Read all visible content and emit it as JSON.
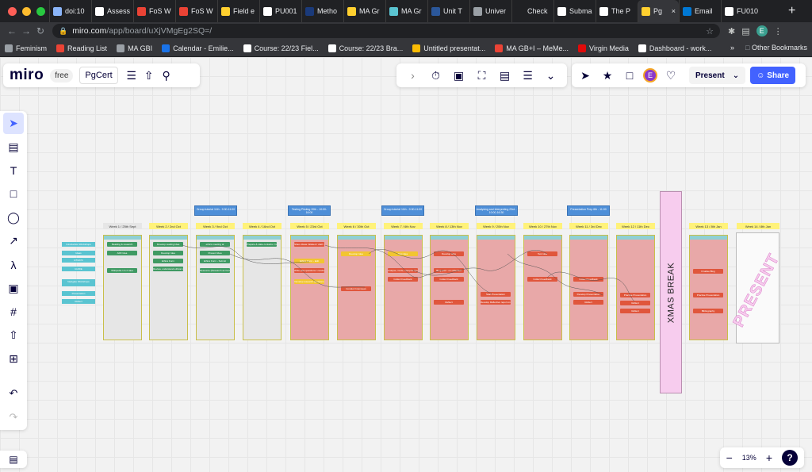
{
  "browser": {
    "tabs": [
      {
        "label": "doi:10",
        "color": "#8ab4f8"
      },
      {
        "label": "Assess",
        "color": "#ffffff"
      },
      {
        "label": "FoS W",
        "color": "#ea4335"
      },
      {
        "label": "FoS W",
        "color": "#ea4335"
      },
      {
        "label": "Field e",
        "color": "#ffd02f"
      },
      {
        "label": "PU001",
        "color": "#ffffff"
      },
      {
        "label": "Metho",
        "color": "#1a3a7a"
      },
      {
        "label": "MA Gr",
        "color": "#ffd02f"
      },
      {
        "label": "MA Gr",
        "color": "#5ac4d1"
      },
      {
        "label": "Unit T",
        "color": "#2b579a"
      },
      {
        "label": "Univer",
        "color": "#9aa0a6"
      },
      {
        "label": "Check",
        "color": "#202124"
      },
      {
        "label": "Subma",
        "color": "#ffffff"
      },
      {
        "label": "The P",
        "color": "#ffffff"
      },
      {
        "label": "Pg",
        "color": "#ffd02f",
        "active": true
      },
      {
        "label": "Email",
        "color": "#0078d4"
      },
      {
        "label": "FU010",
        "color": "#ffffff"
      }
    ],
    "new_tab": "+",
    "url_host": "miro.com",
    "url_path": "/app/board/uXjVMgEg2SQ=/",
    "profile_initial": "E",
    "bookmarks": [
      {
        "label": "Feminism",
        "color": "#9aa0a6"
      },
      {
        "label": "Reading List",
        "color": "#ea4335"
      },
      {
        "label": "MA GBI",
        "color": "#9aa0a6"
      },
      {
        "label": "Calendar - Emilie...",
        "color": "#1a73e8"
      },
      {
        "label": "Course: 22/23 Fiel...",
        "color": "#ffffff"
      },
      {
        "label": "Course: 22/23 Bra...",
        "color": "#ffffff"
      },
      {
        "label": "Untitled presentat...",
        "color": "#fbbc04"
      },
      {
        "label": "MA GB+I – MeMe...",
        "color": "#ea4335"
      },
      {
        "label": "Virgin Media",
        "color": "#e10a0a"
      },
      {
        "label": "Dashboard - work...",
        "color": "#ffffff"
      }
    ],
    "bookmarks_more": "»",
    "other_bookmarks": "Other Bookmarks"
  },
  "miro": {
    "logo": "miro",
    "plan": "free",
    "board_name": "PgCert",
    "present_label": "Present",
    "share_label": "Share",
    "user_initial": "E",
    "zoom_level": "13%",
    "zoom_out": "−",
    "zoom_in": "+",
    "help": "?"
  },
  "board": {
    "weeks": [
      "Week 1 / 25th Sept",
      "Week 2 / 2nd Oct",
      "Week 3 / 9nd Oct",
      "Week 4 / 16nd Oct",
      "Week 5 / 23rd Oct",
      "Week 6 / 30th Oct",
      "Week 7 / 6th Nov",
      "Week 8 / 13th Nov",
      "Week 9 / 20th Nov",
      "Week 10 / 27th Nov",
      "Week 11 / 3rd Dec",
      "Week 12 / 11th Dec",
      "Week 13 / 8th Jan",
      "Week 14 / 8th Jan"
    ],
    "tutorials": [
      "Group tutorial 11th - 9:30-11:00",
      "Testing Piloting 20th - 10:00-16:00",
      "Group tutorial 11th - 9:30-11:00",
      "Analysing and Interpreting 23rd - 10:00-16:30",
      "Presentation Prep 6th - 11:00"
    ],
    "left_labels": [
      "Introduction Workshops",
      "Ideas",
      "ETHICS",
      "GUIDE",
      "Navigate Workshops",
      "Presentation",
      "Reflect"
    ],
    "cards": {
      "c1": [
        "Reading & research",
        "ARF Idea",
        "Wikipedia 1 & 2 Idea"
      ],
      "c2": [
        "Develop reading Idea",
        "Develop Idea",
        "Ethics Form",
        "Review, understand ethical data/knowledge"
      ],
      "c3": [
        "ethics meeting at",
        "Present Idea",
        "Ethics Form - Submit",
        "Resource (Research as transforming learning)"
      ],
      "c4": [
        "Prepare & state contacts / info Interviews"
      ],
      "c5": [
        "Share Ideas Initiated / draft / Participants recruited",
        "Ethics Form - Edit",
        "Write pilot questions / conduct pilot tests",
        "Develop research questions"
      ],
      "c6": [
        "Develop Idea",
        "Conduct Interviews"
      ],
      "c7": [
        "Test idea",
        "Analyse, Code, Interpret Qualitative/Quant Data",
        "Collect Feedback"
      ],
      "c8": [
        "Develop data",
        "Blog post - on reflection",
        "Collect Feedback",
        "Reflect"
      ],
      "c9": [
        "Start Presentation",
        "Develop Reflective report on research"
      ],
      "c10": [
        "Test idea",
        "Collect Feedback"
      ],
      "c11": [
        "Collect Feedback",
        "Develop Presentation",
        "Reflect"
      ],
      "c12": [
        "Practise Presentation",
        "Reflect",
        "Reflect"
      ],
      "c13": [
        "Finalise Blog",
        "Practise Presentation",
        "Bibliography"
      ]
    },
    "xmas": "XMAS BREAK",
    "present_stamp": "PRESENT"
  }
}
